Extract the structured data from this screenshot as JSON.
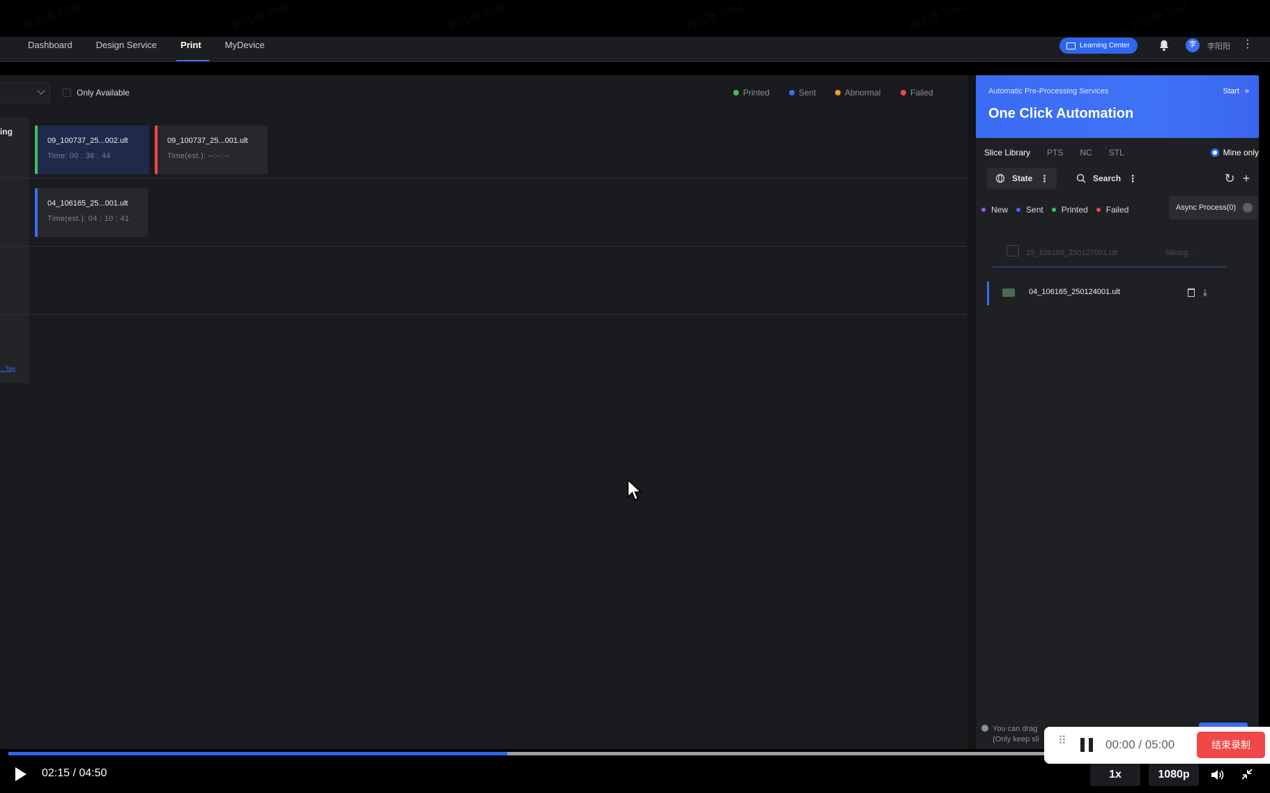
{
  "nav": {
    "items": [
      {
        "label": "Dashboard",
        "active": false
      },
      {
        "label": "Design Service",
        "active": false
      },
      {
        "label": "Print",
        "active": true
      },
      {
        "label": "MyDevice",
        "active": false
      }
    ],
    "learning_center": "Learning Center",
    "avatar_char": "李",
    "username": "李阳阳"
  },
  "filter": {
    "only_available": "Only Available",
    "legend": [
      {
        "label": "Printed",
        "color": "#3fbf5f"
      },
      {
        "label": "Sent",
        "color": "#3b6df0"
      },
      {
        "label": "Abnormal",
        "color": "#f0a030"
      },
      {
        "label": "Failed",
        "color": "#f04848"
      }
    ]
  },
  "rows": {
    "row1_label": "ing",
    "link_text": "...Tap"
  },
  "jobs": [
    {
      "name": "09_100737_25...002.ult",
      "time": "Time:  00 : 36 : 44",
      "accent": "#3fbf5f"
    },
    {
      "name": "09_100737_25...001.ult",
      "time": "Time(est.):  --:--:--",
      "accent": "#f04848"
    },
    {
      "name": "04_106165_25...001.ult",
      "time": "Time(est.):  04 : 10 : 41",
      "accent": "#3b6df0"
    }
  ],
  "promo": {
    "subtitle": "Automatic Pre-Processing Services",
    "title": "One Click Automation",
    "start": "Start"
  },
  "library": {
    "tabs": [
      {
        "label": "Slice Library",
        "active": true
      },
      {
        "label": "PTS",
        "active": false
      },
      {
        "label": "NC",
        "active": false
      },
      {
        "label": "STL",
        "active": false
      }
    ],
    "mine_only": "Mine only",
    "state_label": "State",
    "search_label": "Search",
    "status_legend": [
      {
        "label": "New",
        "color": "#9b59f0"
      },
      {
        "label": "Sent",
        "color": "#3b6df0"
      },
      {
        "label": "Printed",
        "color": "#3fbf5f"
      },
      {
        "label": "Failed",
        "color": "#f04848"
      }
    ],
    "async_label": "Async Process(0)",
    "files": [
      {
        "name": "19_106165_250127001.ult",
        "status": "Slicing..."
      },
      {
        "name": "04_106165_250124001.ult",
        "status": ""
      }
    ],
    "hint_line1": "You can drag",
    "hint_line2": "(Only keep sli"
  },
  "recorder": {
    "time": "00:00 / 05:00",
    "stop_label": "结束录制"
  },
  "player": {
    "time": "02:15 / 04:50",
    "progress_fraction": 0.482,
    "speed": "1x",
    "quality": "1080p"
  },
  "watermark_text": "刘浩杨 7661"
}
